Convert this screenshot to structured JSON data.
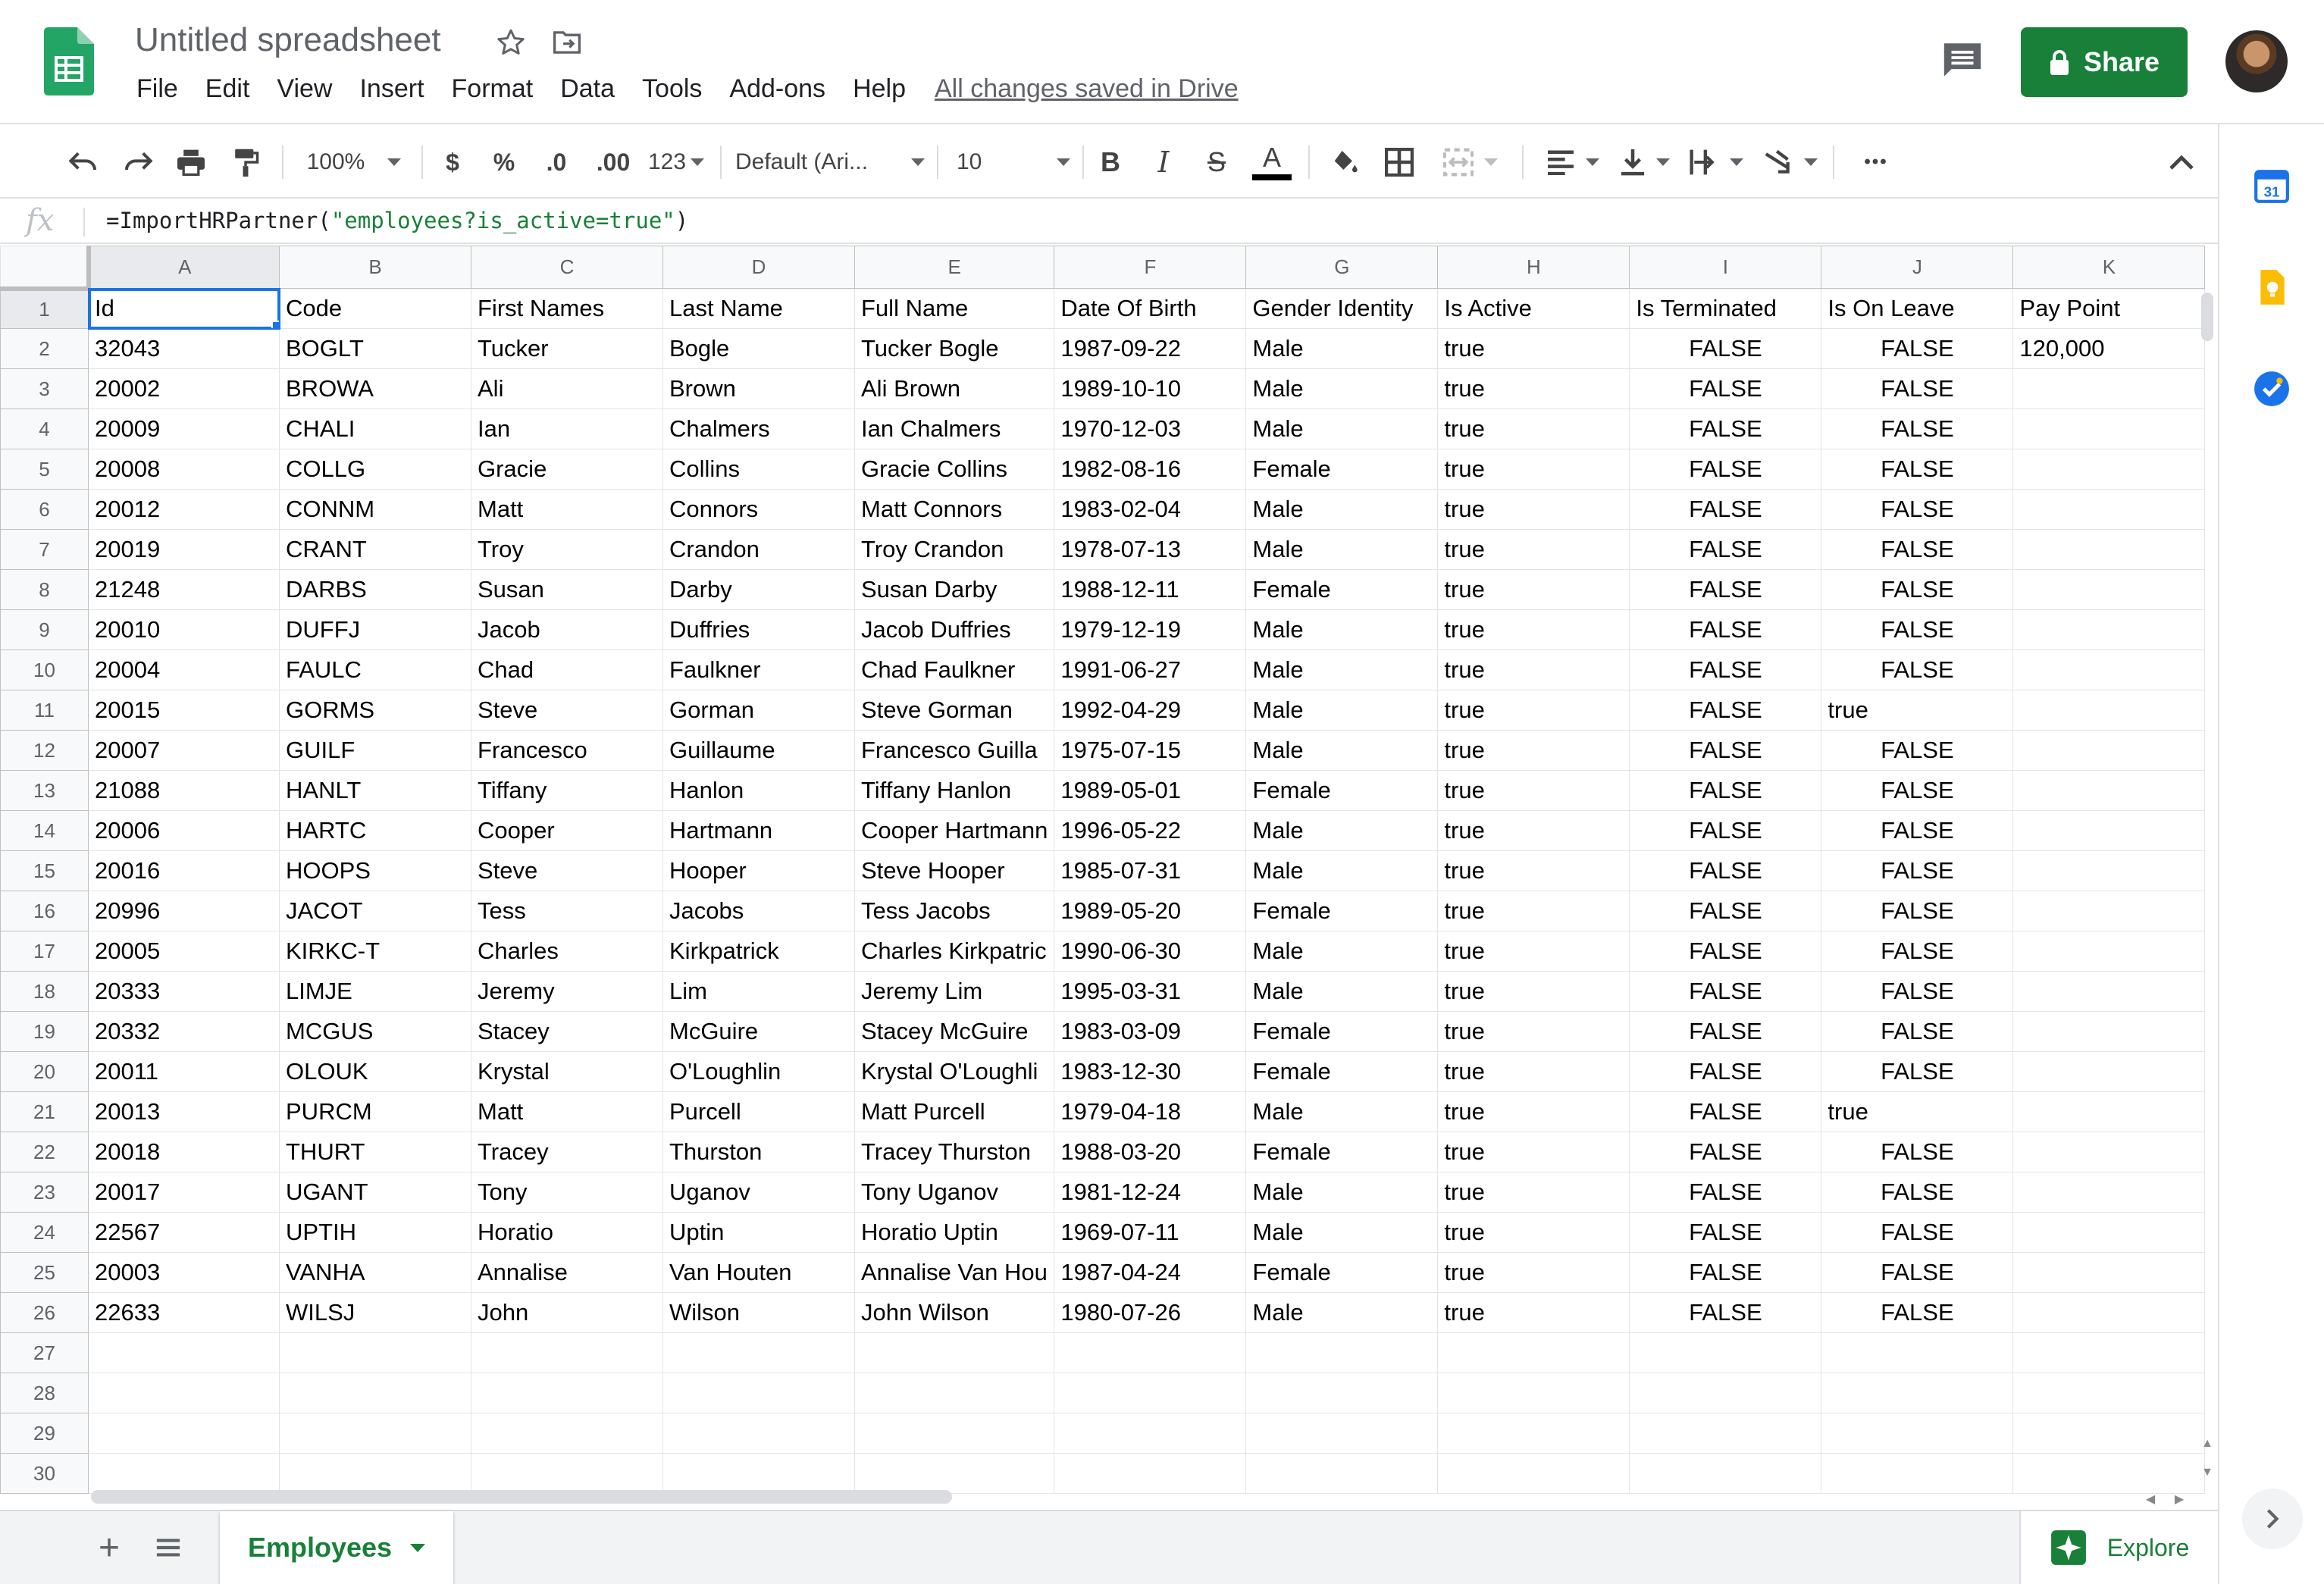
{
  "app": {
    "doc_title": "Untitled spreadsheet",
    "share_label": "Share",
    "saved_status": "All changes saved in Drive",
    "menu": [
      "File",
      "Edit",
      "View",
      "Insert",
      "Format",
      "Data",
      "Tools",
      "Add-ons",
      "Help"
    ]
  },
  "toolbar": {
    "zoom": "100%",
    "currency": "$",
    "percent": "%",
    "decrease_decimal": ".0",
    "increase_decimal": ".00",
    "more_formats": "123",
    "font": "Default (Ari...",
    "font_size": "10",
    "bold": "B",
    "italic": "I",
    "strikethrough": "S",
    "text_color": "A",
    "more": "•••"
  },
  "formula_bar": {
    "fx": "fx",
    "formula_prefix": "=ImportHRPartner(",
    "formula_string": "\"employees?is_active=true\"",
    "formula_suffix": ")"
  },
  "grid": {
    "columns": [
      "A",
      "B",
      "C",
      "D",
      "E",
      "F",
      "G",
      "H",
      "I",
      "J",
      "K"
    ],
    "row_numbers": [
      "1",
      "2",
      "3",
      "4",
      "5",
      "6",
      "7",
      "8",
      "9",
      "10",
      "11",
      "12",
      "13",
      "14",
      "15",
      "16",
      "17",
      "18",
      "19",
      "20",
      "21",
      "22",
      "23",
      "24",
      "25",
      "26",
      "27",
      "28",
      "29",
      "30"
    ],
    "rows": [
      [
        "Id",
        "Code",
        "First Names",
        "Last Name",
        "Full Name",
        "Date Of Birth",
        "Gender Identity",
        "Is Active",
        "Is Terminated",
        "Is On Leave",
        "Pay Point"
      ],
      [
        "32043",
        "BOGLT",
        "Tucker",
        "Bogle",
        "Tucker Bogle",
        "1987-09-22",
        "Male",
        "true",
        "FALSE",
        "FALSE",
        "120,000"
      ],
      [
        "20002",
        "BROWA",
        "Ali",
        "Brown",
        "Ali Brown",
        "1989-10-10",
        "Male",
        "true",
        "FALSE",
        "FALSE",
        ""
      ],
      [
        "20009",
        "CHALI",
        "Ian",
        "Chalmers",
        "Ian Chalmers",
        "1970-12-03",
        "Male",
        "true",
        "FALSE",
        "FALSE",
        ""
      ],
      [
        "20008",
        "COLLG",
        "Gracie",
        "Collins",
        "Gracie Collins",
        "1982-08-16",
        "Female",
        "true",
        "FALSE",
        "FALSE",
        ""
      ],
      [
        "20012",
        "CONNM",
        "Matt",
        "Connors",
        "Matt Connors",
        "1983-02-04",
        "Male",
        "true",
        "FALSE",
        "FALSE",
        ""
      ],
      [
        "20019",
        "CRANT",
        "Troy",
        "Crandon",
        "Troy Crandon",
        "1978-07-13",
        "Male",
        "true",
        "FALSE",
        "FALSE",
        ""
      ],
      [
        "21248",
        "DARBS",
        "Susan",
        "Darby",
        "Susan Darby",
        "1988-12-11",
        "Female",
        "true",
        "FALSE",
        "FALSE",
        ""
      ],
      [
        "20010",
        "DUFFJ",
        "Jacob",
        "Duffries",
        "Jacob Duffries",
        "1979-12-19",
        "Male",
        "true",
        "FALSE",
        "FALSE",
        ""
      ],
      [
        "20004",
        "FAULC",
        "Chad",
        "Faulkner",
        "Chad Faulkner",
        "1991-06-27",
        "Male",
        "true",
        "FALSE",
        "FALSE",
        ""
      ],
      [
        "20015",
        "GORMS",
        "Steve",
        "Gorman",
        "Steve Gorman",
        "1992-04-29",
        "Male",
        "true",
        "FALSE",
        "true",
        ""
      ],
      [
        "20007",
        "GUILF",
        "Francesco",
        "Guillaume",
        "Francesco Guilla",
        "1975-07-15",
        "Male",
        "true",
        "FALSE",
        "FALSE",
        ""
      ],
      [
        "21088",
        "HANLT",
        "Tiffany",
        "Hanlon",
        "Tiffany Hanlon",
        "1989-05-01",
        "Female",
        "true",
        "FALSE",
        "FALSE",
        ""
      ],
      [
        "20006",
        "HARTC",
        "Cooper",
        "Hartmann",
        "Cooper Hartmann",
        "1996-05-22",
        "Male",
        "true",
        "FALSE",
        "FALSE",
        ""
      ],
      [
        "20016",
        "HOOPS",
        "Steve",
        "Hooper",
        "Steve Hooper",
        "1985-07-31",
        "Male",
        "true",
        "FALSE",
        "FALSE",
        ""
      ],
      [
        "20996",
        "JACOT",
        "Tess",
        "Jacobs",
        "Tess Jacobs",
        "1989-05-20",
        "Female",
        "true",
        "FALSE",
        "FALSE",
        ""
      ],
      [
        "20005",
        "KIRKC-T",
        "Charles",
        "Kirkpatrick",
        "Charles Kirkpatric",
        "1990-06-30",
        "Male",
        "true",
        "FALSE",
        "FALSE",
        ""
      ],
      [
        "20333",
        "LIMJE",
        "Jeremy",
        "Lim",
        "Jeremy Lim",
        "1995-03-31",
        "Male",
        "true",
        "FALSE",
        "FALSE",
        ""
      ],
      [
        "20332",
        "MCGUS",
        "Stacey",
        "McGuire",
        "Stacey McGuire",
        "1983-03-09",
        "Female",
        "true",
        "FALSE",
        "FALSE",
        ""
      ],
      [
        "20011",
        "OLOUK",
        "Krystal",
        "O'Loughlin",
        "Krystal O'Loughli",
        "1983-12-30",
        "Female",
        "true",
        "FALSE",
        "FALSE",
        ""
      ],
      [
        "20013",
        "PURCM",
        "Matt",
        "Purcell",
        "Matt Purcell",
        "1979-04-18",
        "Male",
        "true",
        "FALSE",
        "true",
        ""
      ],
      [
        "20018",
        "THURT",
        "Tracey",
        "Thurston",
        "Tracey Thurston",
        "1988-03-20",
        "Female",
        "true",
        "FALSE",
        "FALSE",
        ""
      ],
      [
        "20017",
        "UGANT",
        "Tony",
        "Uganov",
        "Tony Uganov",
        "1981-12-24",
        "Male",
        "true",
        "FALSE",
        "FALSE",
        ""
      ],
      [
        "22567",
        "UPTIH",
        "Horatio",
        "Uptin",
        "Horatio Uptin",
        "1969-07-11",
        "Male",
        "true",
        "FALSE",
        "FALSE",
        ""
      ],
      [
        "20003",
        "VANHA",
        "Annalise",
        "Van Houten",
        "Annalise Van Hou",
        "1987-04-24",
        "Female",
        "true",
        "FALSE",
        "FALSE",
        ""
      ],
      [
        "22633",
        "WILSJ",
        "John",
        "Wilson",
        "John Wilson",
        "1980-07-26",
        "Male",
        "true",
        "FALSE",
        "FALSE",
        ""
      ]
    ]
  },
  "sheets": {
    "tabs": [
      "Employees"
    ],
    "explore_label": "Explore"
  },
  "side_panel": {
    "calendar_day": "31"
  },
  "colors": {
    "brand_green": "#188038",
    "selection_blue": "#1a73e8"
  }
}
